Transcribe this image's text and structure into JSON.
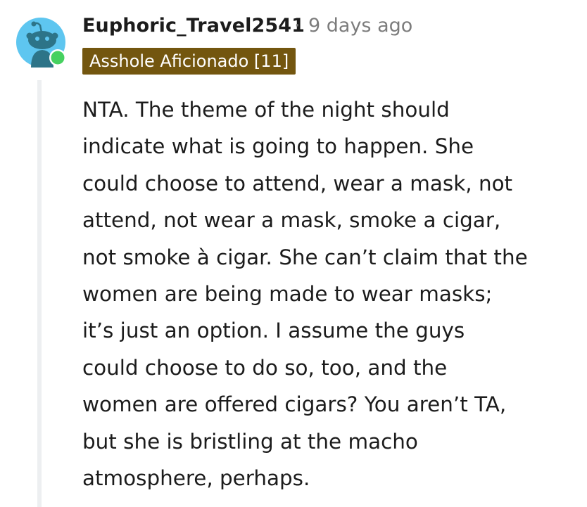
{
  "comment": {
    "author": "Euphoric_Travel2541",
    "separator": "·",
    "timestamp": "9 days ago",
    "flair": "Asshole Aficionado [11]",
    "online": true,
    "avatar_icon": "snoo-avatar-icon",
    "body_lines": [
      "NTA. The theme of the night should",
      "indicate what is going to happen. She",
      "could choose to attend, wear a mask, not",
      "attend, not wear a mask, smoke a cigar,",
      "not smoke à cigar. She can’t claim that the",
      "women are being made to wear masks;",
      "it’s just an option. I assume the guys",
      "could choose to do so, too, and the",
      "women are offered cigars? You aren’t TA,",
      "but she is bristling at the macho",
      "atmosphere, perhaps."
    ]
  },
  "colors": {
    "avatar_bg": "#5ec6f0",
    "online_dot": "#46d160",
    "flair_bg": "#73560f",
    "flair_text": "#ffffff",
    "meta_text": "#7c7c7c",
    "thread_line": "#edeff1"
  }
}
